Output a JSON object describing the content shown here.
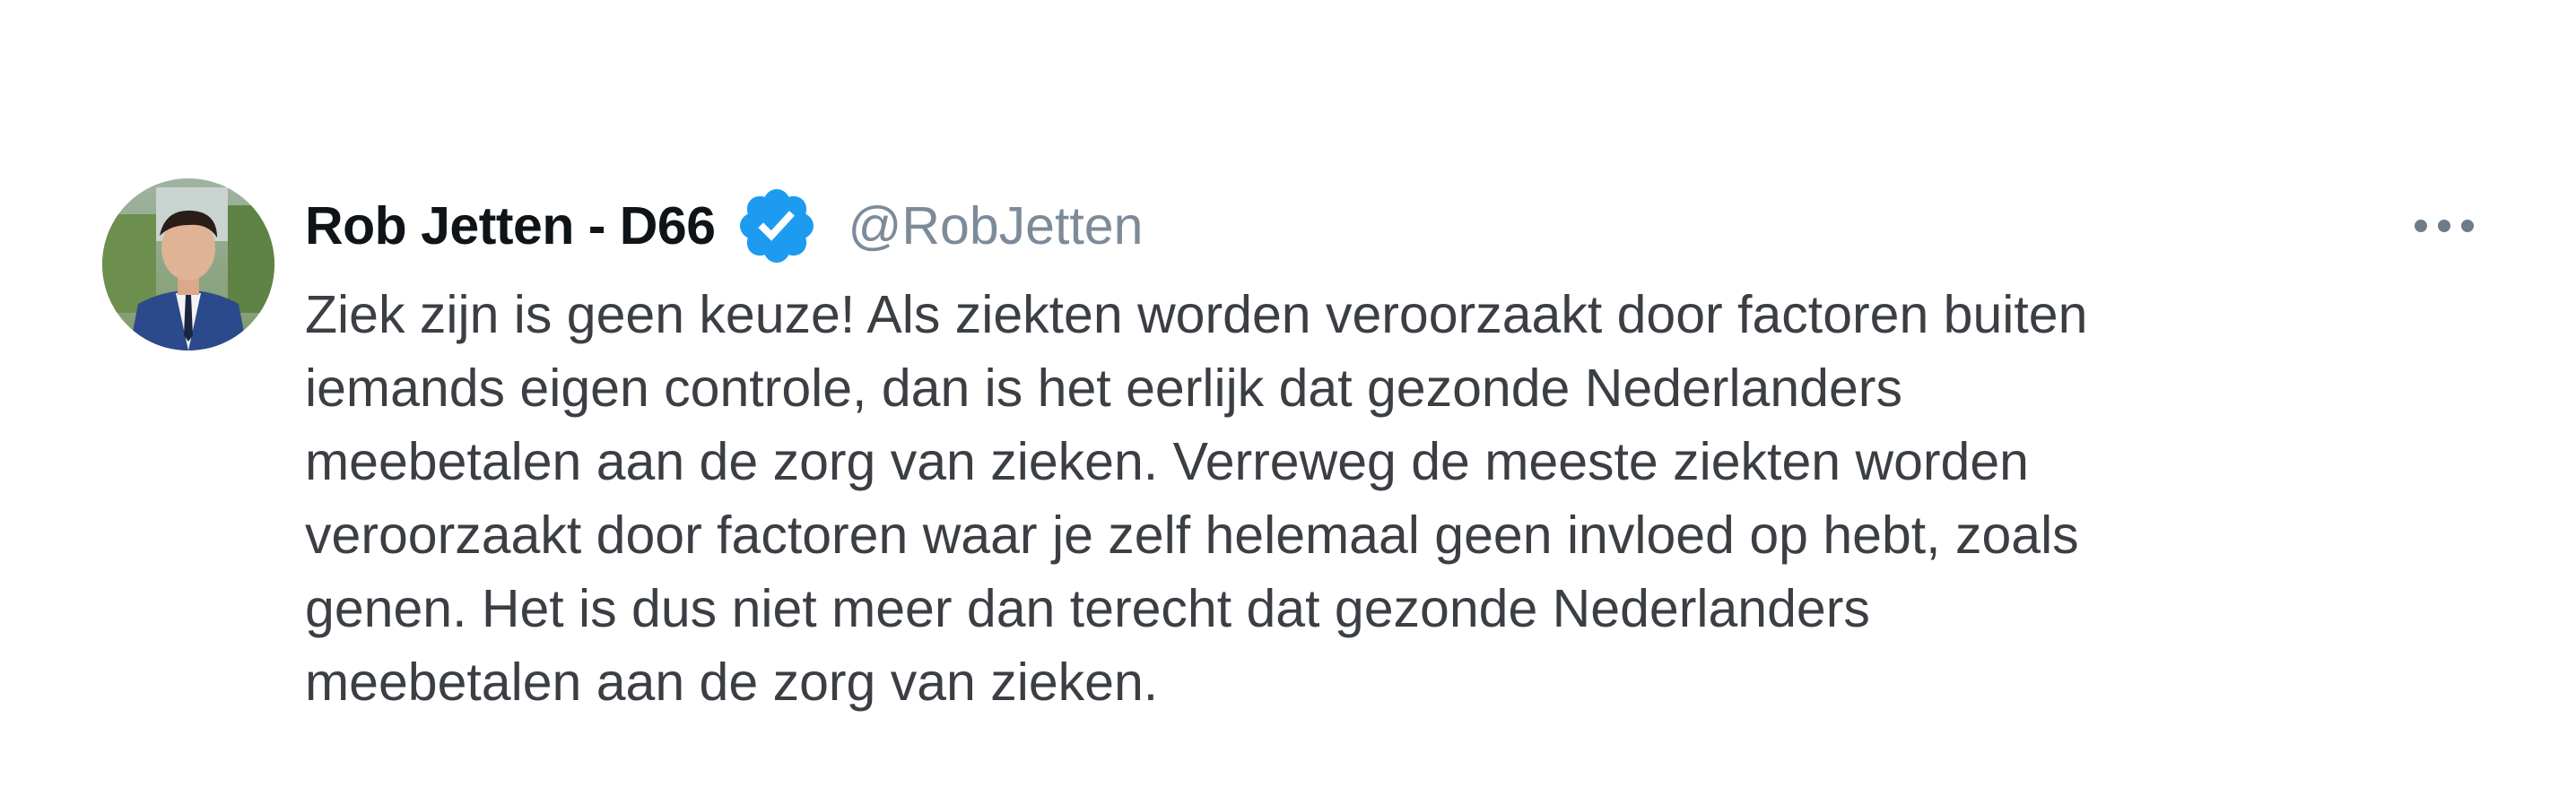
{
  "author": {
    "display_name": "Rob Jetten - D66",
    "handle": "@RobJetten",
    "verified": true
  },
  "icons": {
    "verified": "verified-badge-icon",
    "more": "more-options-icon",
    "avatar": "profile-photo"
  },
  "colors": {
    "verified_blue": "#1d9bf0",
    "handle_gray": "#7d8b99",
    "text": "#3b3f44"
  },
  "tweet": {
    "lines": [
      "Ziek zijn is geen keuze! Als ziekten worden veroorzaakt door factoren buiten",
      "iemands eigen controle, dan is het eerlijk dat gezonde Nederlanders",
      "meebetalen aan de zorg van zieken. Verreweg de meeste ziekten worden",
      "veroorzaakt door factoren waar je zelf helemaal geen invloed op hebt, zoals",
      "genen. Het is dus niet meer dan terecht dat gezonde Nederlanders",
      "meebetalen aan de zorg van zieken."
    ]
  }
}
